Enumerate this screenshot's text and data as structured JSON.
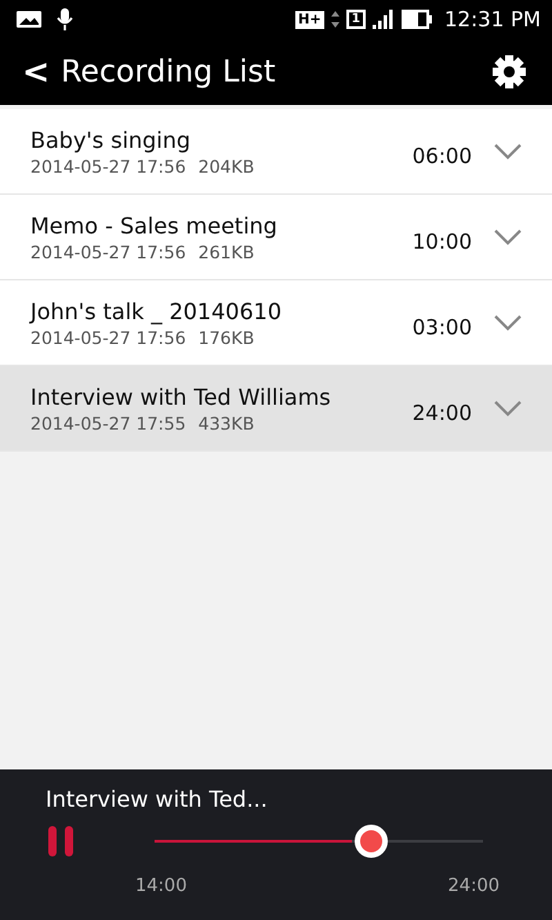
{
  "status_bar": {
    "network": "H+",
    "sim": "1",
    "time": "12:31 PM"
  },
  "header": {
    "back": "<",
    "title": "Recording List"
  },
  "recordings": [
    {
      "title": "Baby's singing",
      "date": "2014-05-27 17:56",
      "size": "204KB",
      "duration": "06:00",
      "selected": false
    },
    {
      "title": "Memo - Sales meeting",
      "date": "2014-05-27 17:56",
      "size": "261KB",
      "duration": "10:00",
      "selected": false
    },
    {
      "title": "John's talk _ 20140610",
      "date": "2014-05-27 17:56",
      "size": "176KB",
      "duration": "03:00",
      "selected": false
    },
    {
      "title": "Interview with Ted Williams",
      "date": "2014-05-27 17:55",
      "size": "433KB",
      "duration": "24:00",
      "selected": true
    }
  ],
  "player": {
    "title": "Interview with Ted...",
    "playing": true,
    "level": 0.6,
    "elapsed": "14:00",
    "total": "24:00"
  }
}
